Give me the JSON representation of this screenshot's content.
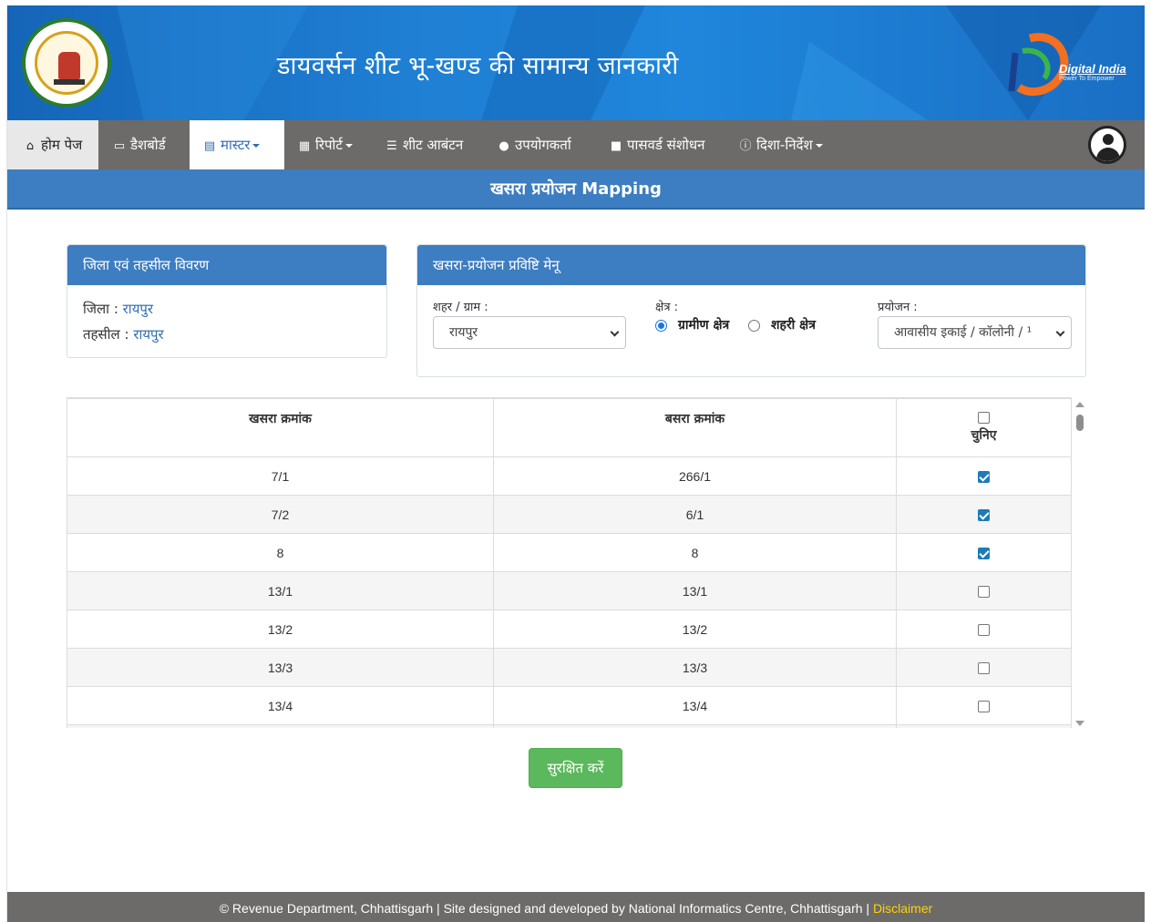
{
  "header": {
    "title": "डायवर्सन शीट भू-खण्ड की सामान्य जानकारी",
    "emblem_text": "छत्तीसगढ़ शासन",
    "digital_india": "Digital India",
    "digital_india_tagline": "Power To Empower"
  },
  "nav": {
    "items": [
      {
        "label": "होम पेज",
        "icon": "home-icon"
      },
      {
        "label": "डैशबोर्ड",
        "icon": "desktop-icon"
      },
      {
        "label": "मास्टर",
        "icon": "id-card-icon",
        "active": true,
        "dropdown": true
      },
      {
        "label": "रिपोर्ट",
        "icon": "newspaper-icon",
        "dropdown": true
      },
      {
        "label": "शीट आबंटन",
        "icon": "list-icon"
      },
      {
        "label": "उपयोगकर्ता",
        "icon": "users-icon"
      },
      {
        "label": "पासवर्ड संशोधन",
        "icon": "lock-icon"
      },
      {
        "label": "दिशा-निर्देश",
        "icon": "info-icon",
        "dropdown": true
      }
    ]
  },
  "page_title": "खसरा प्रयोजन Mapping",
  "district_panel": {
    "title": "जिला एवं तहसील विवरण",
    "district_label": "जिला : ",
    "district_value": "रायपुर",
    "tehsil_label": "तहसील : ",
    "tehsil_value": "रायपुर"
  },
  "entry_panel": {
    "title": "खसरा-प्रयोजन प्रविष्टि मेनू",
    "city_label": "शहर / ग्राम :",
    "city_value": "रायपुर",
    "area_label": "क्षेत्र :",
    "area_options": [
      "ग्रामीण क्षेत्र",
      "शहरी क्षेत्र"
    ],
    "area_selected": "ग्रामीण क्षेत्र",
    "purpose_label": "प्रयोजन :",
    "purpose_value": "आवासीय इकाई / कॉलोनी / ¹"
  },
  "table": {
    "headers": [
      "खसरा क्रमांक",
      "बसरा क्रमांक",
      "चुनिए"
    ],
    "rows": [
      {
        "khasra": "7/1",
        "basra": "266/1",
        "checked": true
      },
      {
        "khasra": "7/2",
        "basra": "6/1",
        "checked": true
      },
      {
        "khasra": "8",
        "basra": "8",
        "checked": true
      },
      {
        "khasra": "13/1",
        "basra": "13/1",
        "checked": false
      },
      {
        "khasra": "13/2",
        "basra": "13/2",
        "checked": false
      },
      {
        "khasra": "13/3",
        "basra": "13/3",
        "checked": false
      },
      {
        "khasra": "13/4",
        "basra": "13/4",
        "checked": false
      }
    ]
  },
  "save_button": "सुरक्षित करें",
  "footer": {
    "text": "© Revenue Department, Chhattisgarh | Site designed and developed by National Informatics Centre, Chhattisgarh | ",
    "disclaimer": "Disclaimer"
  }
}
